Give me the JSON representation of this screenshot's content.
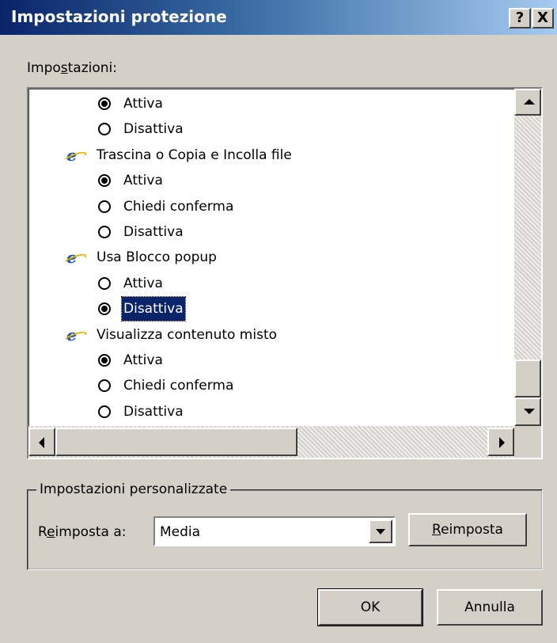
{
  "window": {
    "title": "Impostazioni protezione",
    "help_button": "?",
    "close_button": "X"
  },
  "settings_label": {
    "before": "Impo",
    "accel": "s",
    "after": "tazioni:"
  },
  "tree": {
    "items": [
      {
        "type": "option",
        "label": "Attiva",
        "checked": true
      },
      {
        "type": "option",
        "label": "Disattiva",
        "checked": false
      },
      {
        "type": "category",
        "label": "Trascina o Copia e Incolla file",
        "icon": "ie-icon"
      },
      {
        "type": "option",
        "label": "Attiva",
        "checked": true
      },
      {
        "type": "option",
        "label": "Chiedi conferma",
        "checked": false
      },
      {
        "type": "option",
        "label": "Disattiva",
        "checked": false
      },
      {
        "type": "category",
        "label": "Usa Blocco popup",
        "icon": "ie-icon"
      },
      {
        "type": "option",
        "label": "Attiva",
        "checked": false
      },
      {
        "type": "option",
        "label": "Disattiva",
        "checked": true,
        "selected": true
      },
      {
        "type": "category",
        "label": "Visualizza contenuto misto",
        "icon": "ie-icon"
      },
      {
        "type": "option",
        "label": "Attiva",
        "checked": true
      },
      {
        "type": "option",
        "label": "Chiedi conferma",
        "checked": false
      },
      {
        "type": "option",
        "label": "Disattiva",
        "checked": false
      }
    ]
  },
  "custom_group": {
    "legend": "Impostazioni personalizzate",
    "reset_label": {
      "before": "R",
      "accel": "e",
      "after": "imposta a:"
    },
    "reset_value": "Media",
    "reset_button": {
      "before": "",
      "accel": "R",
      "after": "eimposta"
    }
  },
  "buttons": {
    "ok": "OK",
    "cancel": "Annulla"
  },
  "scroll": {
    "vertical_position": 1.0,
    "horizontal_position": 0.0
  }
}
